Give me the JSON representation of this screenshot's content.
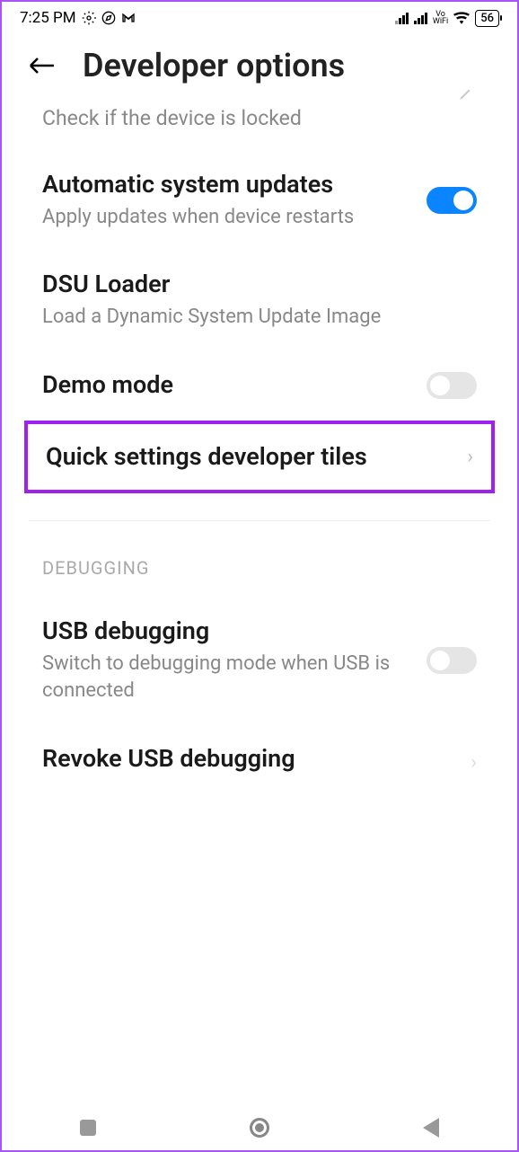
{
  "statusbar": {
    "time": "7:25 PM",
    "battery": "56",
    "volte_top": "Vo",
    "volte_bot": "WiFi"
  },
  "header": {
    "title": "Developer options"
  },
  "items": {
    "lock_check": {
      "subtitle": "Check if the device is locked"
    },
    "auto_updates": {
      "title": "Automatic system updates",
      "subtitle": "Apply updates when device restarts"
    },
    "dsu": {
      "title": "DSU Loader",
      "subtitle": "Load a Dynamic System Update Image"
    },
    "demo": {
      "title": "Demo mode"
    },
    "quick_tiles": {
      "title": "Quick settings developer tiles"
    },
    "usb_debug": {
      "title": "USB debugging",
      "subtitle": "Switch to debugging mode when USB is connected"
    },
    "revoke": {
      "title": "Revoke USB debugging"
    }
  },
  "sections": {
    "debugging": "DEBUGGING"
  }
}
